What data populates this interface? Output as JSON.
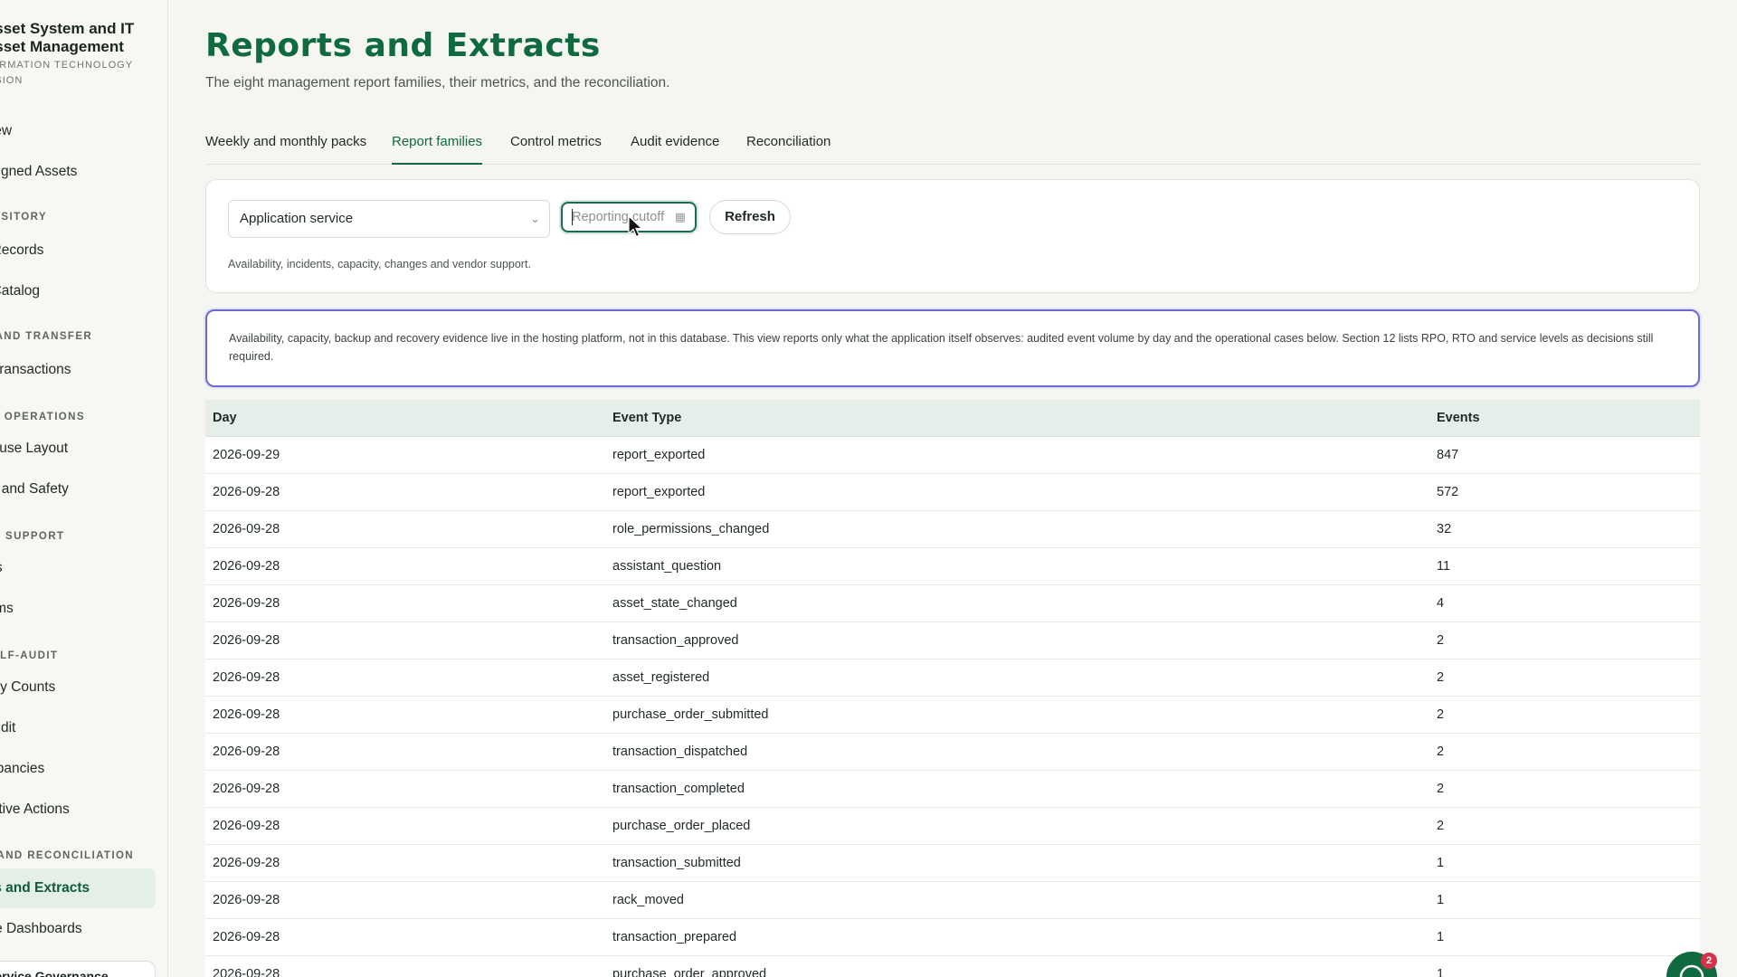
{
  "sidebar": {
    "brand_title": "Asset System and IT Asset Management",
    "brand_subtitle": "FORMATION TECHNOLOGY VISION",
    "items": [
      {
        "label": "view",
        "section": null
      },
      {
        "label": "ssigned Assets",
        "section": null
      },
      {
        "label": "POSITORY",
        "type": "section"
      },
      {
        "label": "t Records"
      },
      {
        "label": "t Catalog"
      },
      {
        "label": "T AND TRANSFER",
        "type": "section"
      },
      {
        "label": "t Transactions"
      },
      {
        "label": "SE OPERATIONS",
        "type": "section"
      },
      {
        "label": "house Layout"
      },
      {
        "label": "ss and Safety"
      },
      {
        "label": "ND SUPPORT",
        "type": "section"
      },
      {
        "label": "ets"
      },
      {
        "label": "lems"
      },
      {
        "label": "SELF-AUDIT",
        "type": "section"
      },
      {
        "label": "tory Counts"
      },
      {
        "label": "Audit"
      },
      {
        "label": "repancies"
      },
      {
        "label": "ective Actions"
      },
      {
        "label": "G AND RECONCILIATION",
        "type": "section"
      },
      {
        "label": "rts and Extracts",
        "active": true
      },
      {
        "label": "ule Dashboards"
      }
    ],
    "bottom_label": "Service Governance"
  },
  "page": {
    "title": "Reports and Extracts",
    "subtitle": "The eight management report families, their metrics, and the reconciliation."
  },
  "tabs": [
    {
      "label": "Weekly and monthly packs",
      "active": false
    },
    {
      "label": "Report families",
      "active": true
    },
    {
      "label": "Control metrics",
      "active": false
    },
    {
      "label": "Audit evidence",
      "active": false
    },
    {
      "label": "Reconciliation",
      "active": false
    }
  ],
  "filters": {
    "family_value": "Application service",
    "date_placeholder": "Reporting cutoff",
    "refresh_label": "Refresh",
    "hint": "Availability, incidents, capacity, changes and vendor support."
  },
  "notice": "Availability, capacity, backup and recovery evidence live in the hosting platform, not in this database. This view reports only what the application itself observes: audited event volume by day and the operational cases below. Section 12 lists RPO, RTO and service levels as decisions still required.",
  "table": {
    "headers": [
      "Day",
      "Event Type",
      "Events"
    ],
    "rows": [
      [
        "2026-09-29",
        "report_exported",
        "847"
      ],
      [
        "2026-09-28",
        "report_exported",
        "572"
      ],
      [
        "2026-09-28",
        "role_permissions_changed",
        "32"
      ],
      [
        "2026-09-28",
        "assistant_question",
        "11"
      ],
      [
        "2026-09-28",
        "asset_state_changed",
        "4"
      ],
      [
        "2026-09-28",
        "transaction_approved",
        "2"
      ],
      [
        "2026-09-28",
        "asset_registered",
        "2"
      ],
      [
        "2026-09-28",
        "purchase_order_submitted",
        "2"
      ],
      [
        "2026-09-28",
        "transaction_dispatched",
        "2"
      ],
      [
        "2026-09-28",
        "transaction_completed",
        "2"
      ],
      [
        "2026-09-28",
        "purchase_order_placed",
        "2"
      ],
      [
        "2026-09-28",
        "transaction_submitted",
        "1"
      ],
      [
        "2026-09-28",
        "rack_moved",
        "1"
      ],
      [
        "2026-09-28",
        "transaction_prepared",
        "1"
      ],
      [
        "2026-09-28",
        "purchase_order_approved",
        "1"
      ]
    ]
  },
  "help": {
    "badge_count": "2"
  },
  "colors": {
    "accent": "#0f6a3f",
    "notice_border": "#6a6ad0",
    "active_nav_bg": "#e3efe7"
  }
}
